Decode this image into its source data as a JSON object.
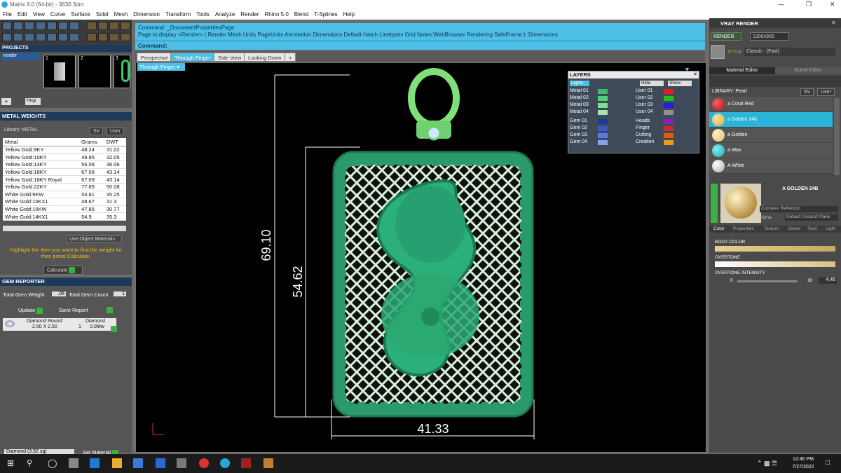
{
  "window": {
    "title": "Matrix 8.0 (64-bit) - 3630.3dm"
  },
  "menu": [
    "File",
    "Edit",
    "View",
    "Curve",
    "Surface",
    "Solid",
    "Mesh",
    "Dimension",
    "Transform",
    "Tools",
    "Analyze",
    "Render",
    "Rhino 5.0",
    "Blend",
    "T-Splines",
    "Help"
  ],
  "projects": {
    "title": "PROJECTS",
    "item": "render",
    "slots": [
      "1",
      "2",
      "3"
    ],
    "buttons": [
      "Hngr"
    ]
  },
  "metal_weights": {
    "title": "METAL WEIGHTS",
    "library_label": "Library: METAL",
    "sv": "SV",
    "user": "User",
    "columns": [
      "Metal",
      "Grams",
      "DWT"
    ],
    "rows": [
      [
        "Yellow Gold:9KY",
        "48.24",
        "31.02"
      ],
      [
        "Yellow Gold:10KY",
        "49.85",
        "32.05"
      ],
      [
        "Yellow Gold:14KY",
        "56.08",
        "36.06"
      ],
      [
        "Yellow Gold:18KY",
        "67.09",
        "43.14"
      ],
      [
        "Yellow Gold:18KY Royal",
        "67.09",
        "43.14"
      ],
      [
        "Yellow Gold:22KY",
        "77.89",
        "50.08"
      ],
      [
        "White Gold:9KW",
        "54.81",
        "35.25"
      ],
      [
        "White Gold:10KX1",
        "48.67",
        "31.3"
      ],
      [
        "White Gold:10KW",
        "47.85",
        "30.77"
      ],
      [
        "White Gold:14KX1",
        "54.9",
        "35.3"
      ]
    ],
    "use_object_materials": "Use Object Materials",
    "hint": "Highlight the item you want to find the weight for then press Calculate.",
    "calculate": "Calculate"
  },
  "gem_reporter": {
    "title": "GEM REPORTER",
    "total_weight_label": "Total Gem Weight",
    "total_weight": ".06",
    "total_count_label": "Total Gem Count",
    "total_count": "1",
    "update": "Update",
    "save_report": "Save Report",
    "gem": {
      "shape": "Diamond Round",
      "size": "2.50 X 2.50",
      "material": "Diamond",
      "qty": "1",
      "weight": "0.06tw"
    }
  },
  "bottom_left": {
    "material_select": "Diamond",
    "sg": "(3.52 sg)",
    "set_material": "Set Material"
  },
  "command": {
    "line1": "Command: _DocumentPropertiesPage",
    "line2": "Page to display <Render> ( Render  Mesh  Units  PageUnits  Annotation  Dimensions  Default  Hatch  Linetypes  Grid  Notes  WebBrowser  Rendering  SafeFrame ): Dimensions",
    "prompt": "Command:"
  },
  "viewport_tabs": [
    "Perspective",
    "Through Finger",
    "Side View",
    "Looking Down",
    "+"
  ],
  "viewport_label": "Through Finger",
  "dimensions": {
    "total_height": "69.10",
    "body_height": "54.62",
    "width": "41.33"
  },
  "layers": {
    "title": "LAYERS",
    "lights": "Lights",
    "hide": "Hide",
    "show": "Show",
    "left": [
      [
        "Metal 01",
        "#3cbf6a"
      ],
      [
        "Metal 02",
        "#4cd07a"
      ],
      [
        "Metal 03",
        "#7fe08f"
      ],
      [
        "Metal 04",
        "#9fe8a8"
      ],
      [
        "Gem 01",
        "#1a3a9a"
      ],
      [
        "Gem 02",
        "#3a5acb"
      ],
      [
        "Gem 03",
        "#5a7ae0"
      ],
      [
        "Gem 04",
        "#8aa0f0"
      ]
    ],
    "right": [
      [
        "User 01",
        "#e02020"
      ],
      [
        "User 02",
        "#20c020"
      ],
      [
        "User 03",
        "#2020e0"
      ],
      [
        "User 04",
        "#909090"
      ],
      [
        "Heads",
        "#8a20c0"
      ],
      [
        "Finger",
        "#c03030"
      ],
      [
        "Cutting",
        "#e05a10"
      ],
      [
        "Creation",
        "#e0a010"
      ]
    ]
  },
  "vray": {
    "title": "VRAY RENDER",
    "render": "RENDER",
    "resolution": "1200x900",
    "style_label": "STYLE",
    "style": "Classic - (Fast)",
    "tabs": [
      "Material Editor",
      "Scene Editor"
    ],
    "library": "LIBRARY: Pearl",
    "sv": "SV",
    "user": "User",
    "materials": [
      [
        "a Coral Red",
        "#b01818"
      ],
      [
        "a Golden 24b",
        "#d4aa4a"
      ],
      [
        "a Golden",
        "#d8c070"
      ],
      [
        "a Wax",
        "#20a8b0"
      ],
      [
        "A White",
        "#e8e8e8"
      ]
    ],
    "selected": "A GOLDEN 24B",
    "preview_fields": [
      "Complex Reflection",
      "Alpha",
      "Default Ground Plane"
    ],
    "subtabs": [
      "Color",
      "Properties",
      "Texture",
      "Scene",
      "Toon",
      "Light"
    ],
    "body_color": "BODY COLOR",
    "overtone": "OVERTONE",
    "overtone_intensity": "OVERTONE INTENSITY",
    "intensity_min": "0",
    "intensity_max": "10",
    "intensity_value": "4.45"
  },
  "taskbar": {
    "time": "12:46 PM",
    "date": "7/27/2022"
  }
}
